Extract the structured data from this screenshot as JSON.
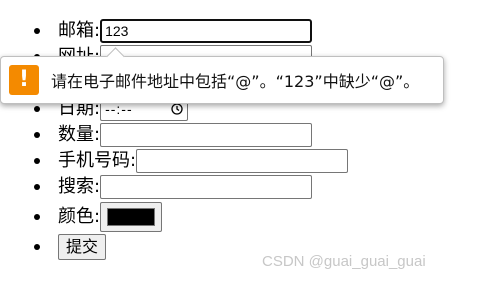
{
  "form": {
    "email": {
      "label": "邮箱:",
      "value": "123"
    },
    "url": {
      "label": "网址:",
      "value": ""
    },
    "date": {
      "label": "日期:",
      "value": "--:--"
    },
    "quantity": {
      "label": "数量:",
      "value": ""
    },
    "phone": {
      "label": "手机号码:",
      "value": ""
    },
    "search": {
      "label": "搜索:",
      "value": ""
    },
    "color": {
      "label": "颜色:",
      "value": "#000000"
    },
    "submit": {
      "label": "提交"
    }
  },
  "tooltip": {
    "icon": "warning-icon",
    "icon_glyph": "!",
    "icon_color": "#f48a00",
    "message": "请在电子邮件地址中包括“@”。“123”中缺少“@”。"
  },
  "watermark": "CSDN @guai_guai_guai"
}
